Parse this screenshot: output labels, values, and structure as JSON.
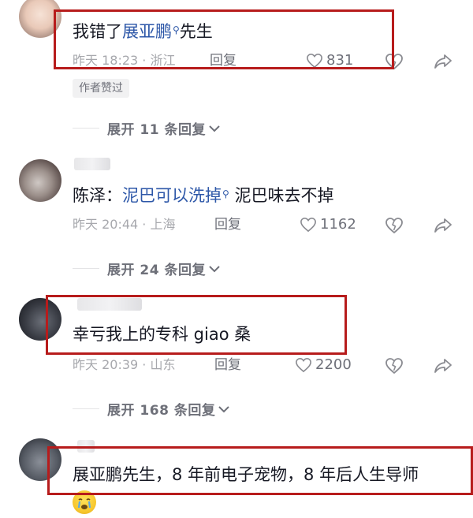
{
  "comments": [
    {
      "text_link": "展亚鹏",
      "text_after": "先生",
      "time_location": "昨天 18:23 · 浙江",
      "reply_label": "回复",
      "likes": "831",
      "badge": "作者赞过",
      "expand_label": "展开 11 条回复"
    },
    {
      "text_prefix": "陈泽：",
      "text_link": "泥巴可以洗掉",
      "text_after": "泥巴味去不掉",
      "time_location": "昨天 20:44 · 上海",
      "reply_label": "回复",
      "likes": "1162",
      "expand_label": "展开 24 条回复"
    },
    {
      "text": "幸亏我上的专科 giao 桑",
      "time_location": "昨天 20:39 · 山东",
      "reply_label": "回复",
      "likes": "2200",
      "expand_label": "展开 168 条回复"
    },
    {
      "text": "展亚鹏先生，8 年前电子宠物，8 年后人生导师"
    }
  ],
  "first_comment_prefix": "我错了",
  "icons": [
    "heart-icon",
    "dislike-heart-icon",
    "share-icon",
    "chevron-down-icon",
    "search-magnifier-icon",
    "crying-emoji-icon"
  ],
  "accent_colors": {
    "link": "#2d57a8",
    "highlight_box": "#b71c1c",
    "meta_gray": "#a7a8ad"
  }
}
